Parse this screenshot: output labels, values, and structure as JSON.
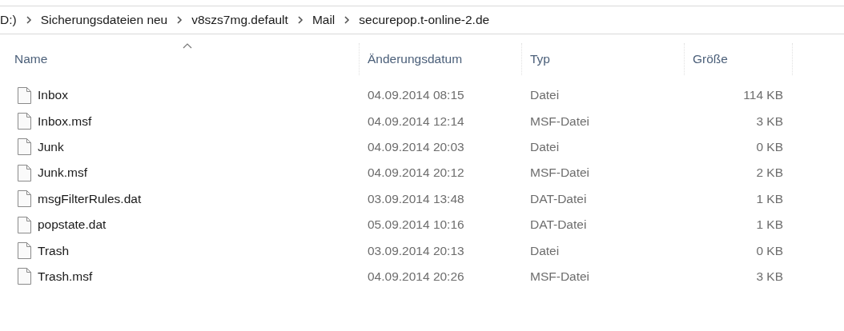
{
  "breadcrumb": [
    "D:)",
    "Sicherungsdateien neu",
    "v8szs7mg.default",
    "Mail",
    "securepop.t-online-2.de"
  ],
  "columns": [
    {
      "label": "Name",
      "sorted": true
    },
    {
      "label": "Änderungsdatum",
      "sorted": false
    },
    {
      "label": "Typ",
      "sorted": false
    },
    {
      "label": "Größe",
      "sorted": false
    }
  ],
  "rows": [
    {
      "name": "Inbox",
      "date": "04.09.2014 08:15",
      "type": "Datei",
      "size": "114 KB"
    },
    {
      "name": "Inbox.msf",
      "date": "04.09.2014 12:14",
      "type": "MSF-Datei",
      "size": "3 KB"
    },
    {
      "name": "Junk",
      "date": "04.09.2014 20:03",
      "type": "Datei",
      "size": "0 KB"
    },
    {
      "name": "Junk.msf",
      "date": "04.09.2014 20:12",
      "type": "MSF-Datei",
      "size": "2 KB"
    },
    {
      "name": "msgFilterRules.dat",
      "date": "03.09.2014 13:48",
      "type": "DAT-Datei",
      "size": "1 KB"
    },
    {
      "name": "popstate.dat",
      "date": "05.09.2014 10:16",
      "type": "DAT-Datei",
      "size": "1 KB"
    },
    {
      "name": "Trash",
      "date": "03.09.2014 20:13",
      "type": "Datei",
      "size": "0 KB"
    },
    {
      "name": "Trash.msf",
      "date": "04.09.2014 20:26",
      "type": "MSF-Datei",
      "size": "3 KB"
    }
  ]
}
